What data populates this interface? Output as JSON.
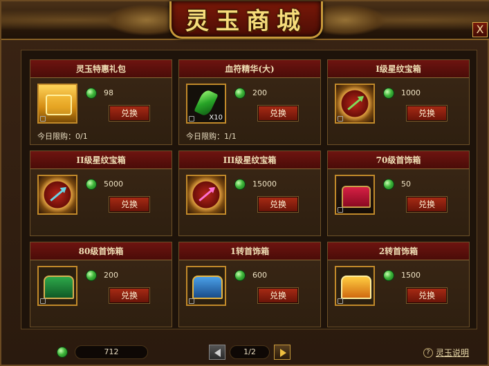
{
  "window": {
    "title": "灵玉商城",
    "close_label": "X"
  },
  "items": [
    {
      "title": "灵玉特惠礼包",
      "price": "98",
      "button": "兑换",
      "limit": "今日限购：0/1",
      "art": "gold-chest"
    },
    {
      "title": "血符精华(大)",
      "price": "200",
      "button": "兑换",
      "limit": "今日限购：1/1",
      "art": "green-crystal",
      "qty": "X10"
    },
    {
      "title": "I级星纹宝箱",
      "price": "1000",
      "button": "兑换",
      "art": "star-box",
      "arrow_color": "#7fdc5a"
    },
    {
      "title": "II级星纹宝箱",
      "price": "5000",
      "button": "兑换",
      "art": "star-box",
      "arrow_color": "#6ad4e6"
    },
    {
      "title": "III级星纹宝箱",
      "price": "15000",
      "button": "兑换",
      "art": "star-box",
      "arrow_color": "#ff6fd2"
    },
    {
      "title": "70级首饰箱",
      "price": "50",
      "button": "兑换",
      "art": "red-chest"
    },
    {
      "title": "80级首饰箱",
      "price": "200",
      "button": "兑换",
      "art": "green-chest"
    },
    {
      "title": "1转首饰箱",
      "price": "600",
      "button": "兑换",
      "art": "blue-chest"
    },
    {
      "title": "2转首饰箱",
      "price": "1500",
      "button": "兑换",
      "art": "orange-chest"
    }
  ],
  "footer": {
    "balance": "712",
    "page": "1/2",
    "help_label": "灵玉说明",
    "help_icon": "?"
  }
}
